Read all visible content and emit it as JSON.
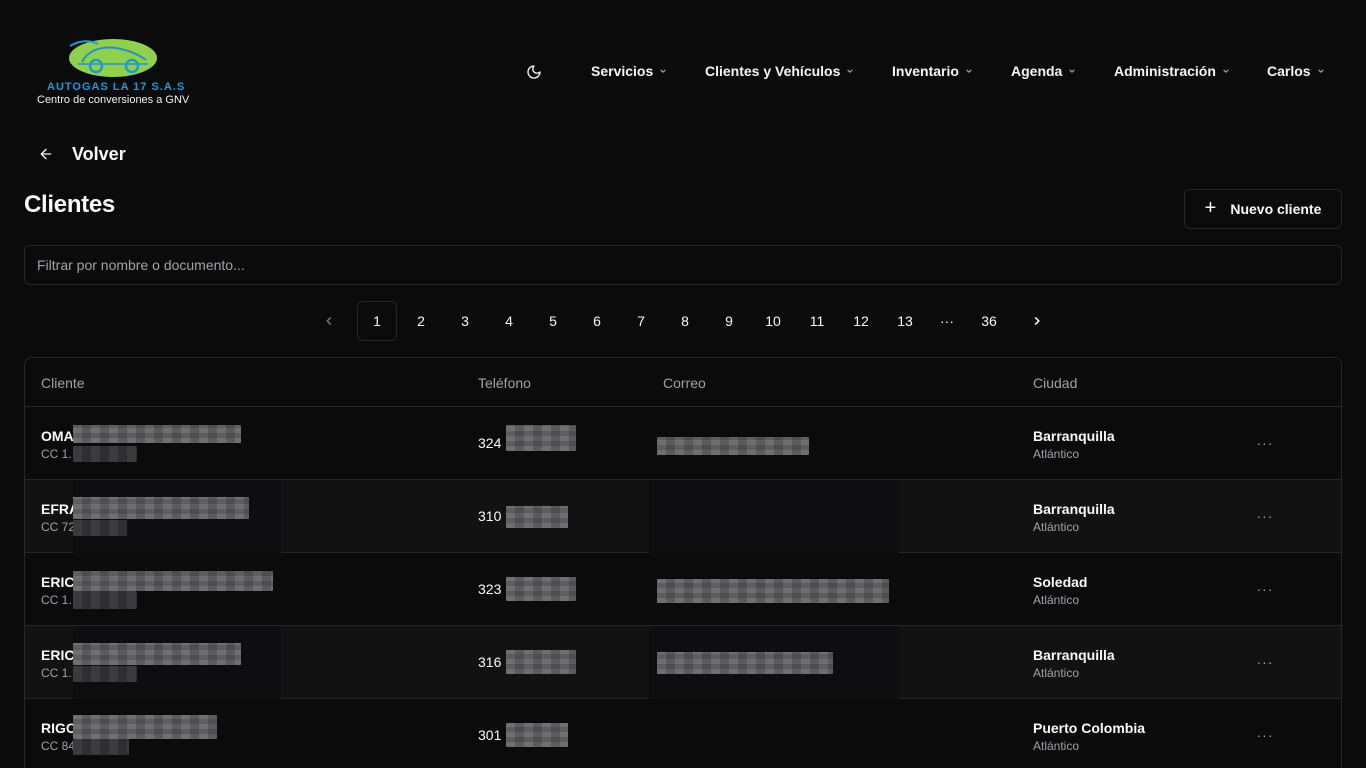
{
  "brand": {
    "title": "AUTOGAS LA 17 S.A.S",
    "subtitle": "Centro de conversiones a GNV",
    "colors": {
      "title": "#1d9bd1",
      "car": "#8fd14f"
    }
  },
  "header": {
    "theme_icon": "moon-icon",
    "nav": [
      {
        "label": "Servicios"
      },
      {
        "label": "Clientes y Vehículos"
      },
      {
        "label": "Inventario"
      },
      {
        "label": "Agenda"
      },
      {
        "label": "Administración"
      },
      {
        "label": "Carlos"
      }
    ]
  },
  "back": {
    "label": "Volver",
    "icon": "arrow-left-icon"
  },
  "page": {
    "title": "Clientes"
  },
  "actions": {
    "new_client": "Nuevo cliente",
    "new_client_icon": "plus-icon"
  },
  "filter": {
    "placeholder": "Filtrar por nombre o documento...",
    "value": ""
  },
  "pagination": {
    "current": "1",
    "pages": [
      "1",
      "2",
      "3",
      "4",
      "5",
      "6",
      "7",
      "8",
      "9",
      "10",
      "11",
      "12",
      "13"
    ],
    "ellipsis": "···",
    "last": "36"
  },
  "table": {
    "columns": {
      "client": "Cliente",
      "phone": "Teléfono",
      "email": "Correo",
      "city": "Ciudad"
    },
    "rows": [
      {
        "name": "OMA",
        "doc": "CC 1.",
        "phone": "324",
        "email": "",
        "city": "Barranquilla",
        "dept": "Atlántico"
      },
      {
        "name": "EFRA",
        "doc": "CC 72",
        "phone": "310",
        "email": "",
        "city": "Barranquilla",
        "dept": "Atlántico"
      },
      {
        "name": "ERIC",
        "doc": "CC 1.",
        "phone": "323",
        "email": "",
        "city": "Soledad",
        "dept": "Atlántico"
      },
      {
        "name": "ERIC",
        "doc": "CC 1.",
        "phone": "316",
        "email": "",
        "city": "Barranquilla",
        "dept": "Atlántico"
      },
      {
        "name": "RIGO",
        "doc": "CC 84",
        "phone": "301",
        "email": "",
        "city": "Puerto Colombia",
        "dept": "Atlántico"
      }
    ],
    "row_menu_icon": "more-horizontal-icon",
    "row_menu_label": "···"
  }
}
